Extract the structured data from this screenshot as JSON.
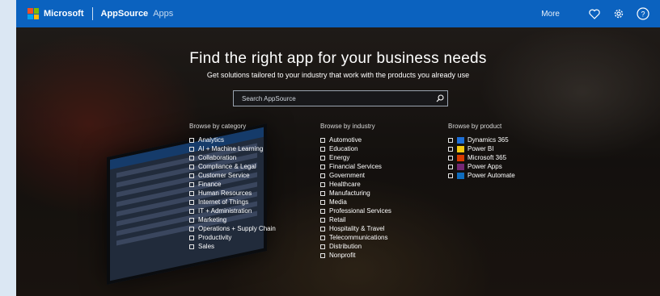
{
  "header": {
    "brand": "Microsoft",
    "app_name": "AppSource",
    "app_sub": "Apps",
    "user_link": "More",
    "icons": [
      "heart-icon",
      "settings-icon",
      "help-icon"
    ]
  },
  "hero": {
    "title": "Find the right app for your business needs",
    "subtitle": "Get solutions tailored to your industry that work with the products you already use",
    "search_placeholder": "Search AppSource"
  },
  "categories": {
    "title": "Browse by category",
    "items": [
      "Analytics",
      "AI + Machine Learning",
      "Collaboration",
      "Compliance & Legal",
      "Customer Service",
      "Finance",
      "Human Resources",
      "Internet of Things",
      "IT + Administration",
      "Marketing",
      "Operations + Supply Chain",
      "Productivity",
      "Sales"
    ]
  },
  "industries": {
    "title": "Browse by industry",
    "items": [
      "Automotive",
      "Education",
      "Energy",
      "Financial Services",
      "Government",
      "Healthcare",
      "Manufacturing",
      "Media",
      "Professional Services",
      "Retail",
      "Hospitality & Travel",
      "Telecommunications",
      "Distribution",
      "Nonprofit"
    ]
  },
  "products": {
    "title": "Browse by product",
    "items": [
      {
        "label": "Dynamics 365",
        "color": "#1e6fd6"
      },
      {
        "label": "Power BI",
        "color": "#f2c811"
      },
      {
        "label": "Microsoft 365",
        "color": "#d83b01"
      },
      {
        "label": "Power Apps",
        "color": "#742774"
      },
      {
        "label": "Power Automate",
        "color": "#0f6cbd"
      }
    ]
  },
  "colors": {
    "header_bg": "#0b62bf",
    "ms_logo": [
      "#f25022",
      "#7fba00",
      "#00a4ef",
      "#ffb900"
    ]
  }
}
